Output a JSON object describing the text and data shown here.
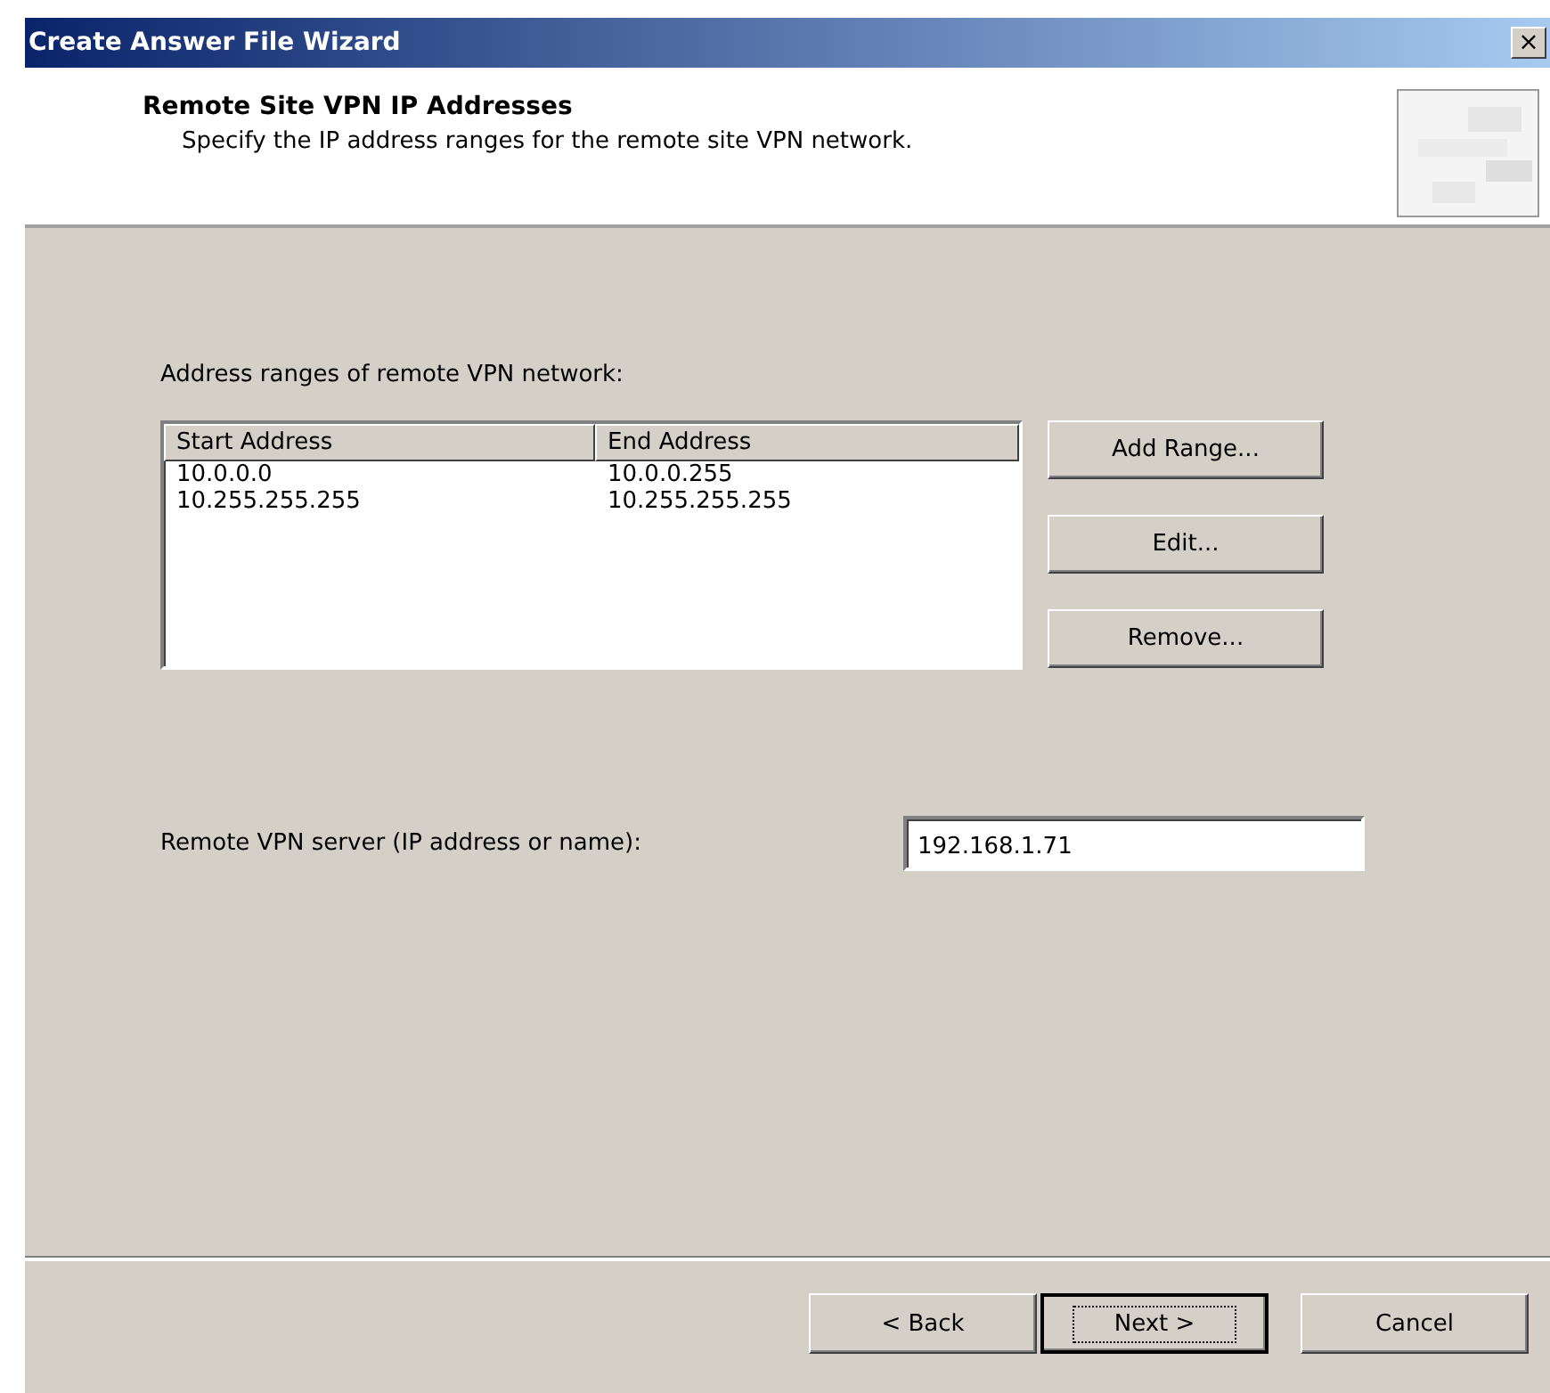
{
  "window": {
    "title": "Create Answer File Wizard",
    "close": "×"
  },
  "header": {
    "title": "Remote Site VPN IP Addresses",
    "subtitle": "Specify the IP address ranges for the remote site VPN network."
  },
  "ranges": {
    "label": "Address ranges of remote VPN network:",
    "columns": [
      "Start Address",
      "End Address"
    ],
    "rows": [
      [
        "10.0.0.0",
        "10.0.0.255"
      ],
      [
        "10.255.255.255",
        "10.255.255.255"
      ]
    ]
  },
  "range_buttons": [
    {
      "label": "Add Range..."
    },
    {
      "label": "Edit..."
    },
    {
      "label": "Remove..."
    }
  ],
  "server": {
    "label": "Remote VPN server (IP address or name):",
    "value": "192.168.1.71"
  },
  "buttons": [
    {
      "label": "< Back",
      "default": false
    },
    {
      "label": "Next >",
      "default": true
    },
    {
      "label": "Cancel",
      "default": false
    }
  ]
}
